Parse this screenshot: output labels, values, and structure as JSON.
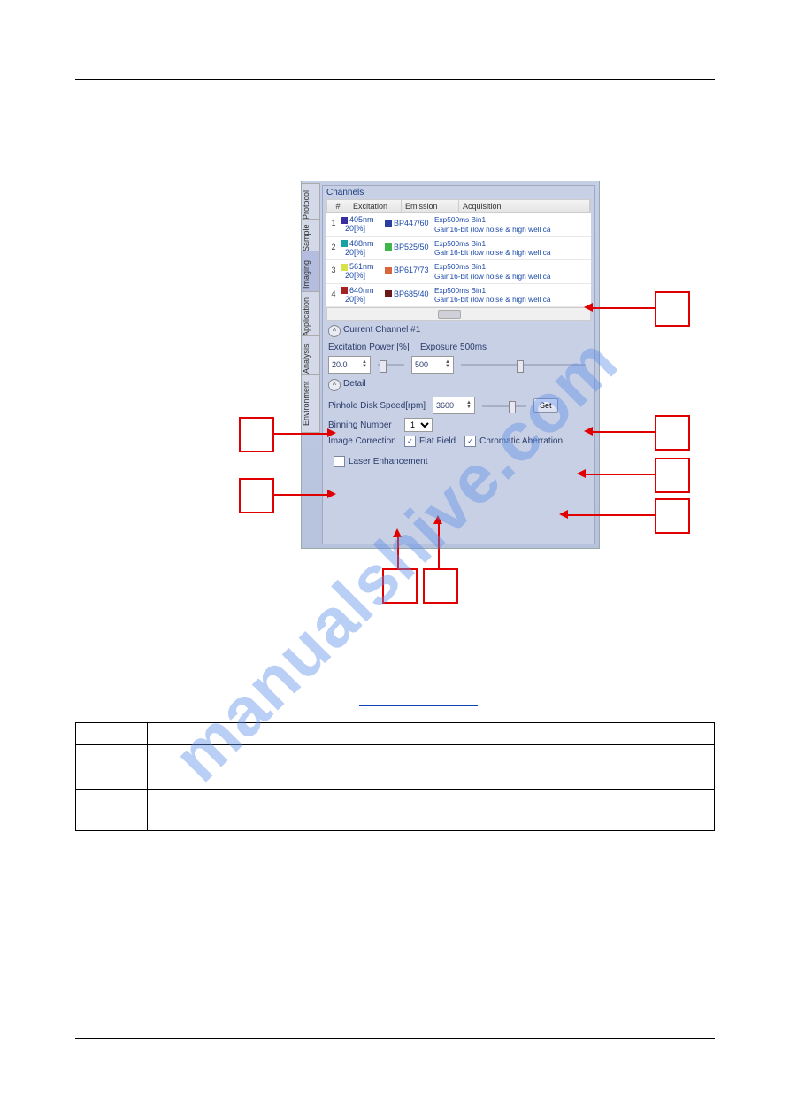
{
  "side_tabs": [
    "Protocol",
    "Sample",
    "Imaging",
    "Application",
    "Analysis",
    "Environment"
  ],
  "channels": {
    "title": "Channels",
    "headers": {
      "num": "#",
      "excitation": "Excitation",
      "emission": "Emission",
      "acquisition": "Acquisition"
    },
    "rows": [
      {
        "num": "1",
        "exc_nm": "405nm",
        "exc_pct": "20[%]",
        "exc_color": "#3a2f9e",
        "emi": "BP447/60",
        "emi_color": "#2b3fa0",
        "acq_l1": "Exp500ms Bin1",
        "acq_l2": "Gain16-bit (low noise & high well ca"
      },
      {
        "num": "2",
        "exc_nm": "488nm",
        "exc_pct": "20[%]",
        "exc_color": "#18a2a8",
        "emi": "BP525/50",
        "emi_color": "#3fb64a",
        "acq_l1": "Exp500ms Bin1",
        "acq_l2": "Gain16-bit (low noise & high well ca"
      },
      {
        "num": "3",
        "exc_nm": "561nm",
        "exc_pct": "20[%]",
        "exc_color": "#d7e24a",
        "emi": "BP617/73",
        "emi_color": "#d8663d",
        "acq_l1": "Exp500ms Bin1",
        "acq_l2": "Gain16-bit (low noise & high well ca"
      },
      {
        "num": "4",
        "exc_nm": "640nm",
        "exc_pct": "20[%]",
        "exc_color": "#a52222",
        "emi": "BP685/40",
        "emi_color": "#6b1818",
        "acq_l1": "Exp500ms Bin1",
        "acq_l2": "Gain16-bit (low noise & high well ca"
      }
    ]
  },
  "current_channel": {
    "label": "Current Channel  #1"
  },
  "excitation_power": {
    "label": "Excitation Power [%]",
    "value": "20.0"
  },
  "exposure": {
    "label": "Exposure  500ms",
    "value": "500"
  },
  "detail": {
    "label": "Detail"
  },
  "pinhole": {
    "label": "Pinhole Disk Speed[rpm]",
    "value": "3600",
    "set": "Set"
  },
  "binning": {
    "label": "Binning Number",
    "value": "1"
  },
  "image_correction": {
    "label": "Image Correction",
    "flat": "Flat Field",
    "chroma": "Chromatic Aberration"
  },
  "laser_enh": {
    "label": "Laser Enhancement"
  },
  "watermark": "manualshive.com"
}
